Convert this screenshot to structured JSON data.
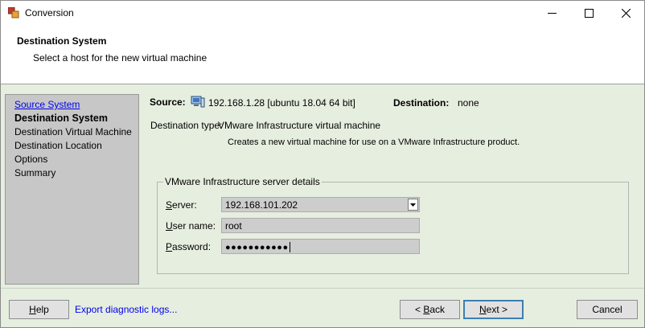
{
  "window": {
    "title": "Conversion",
    "icon": "vmware-converter-icon",
    "controls": [
      "minimize-icon",
      "maximize-icon",
      "close-icon"
    ]
  },
  "header": {
    "title": "Destination System",
    "subtitle": "Select a host for the new virtual machine"
  },
  "nav": {
    "items": [
      {
        "label": "Source System",
        "state": "link"
      },
      {
        "label": "Destination System",
        "state": "current"
      },
      {
        "label": "Destination Virtual Machine",
        "state": "normal"
      },
      {
        "label": "Destination Location",
        "state": "normal"
      },
      {
        "label": "Options",
        "state": "normal"
      },
      {
        "label": "Summary",
        "state": "normal"
      }
    ]
  },
  "content": {
    "source_label": "Source:",
    "source_icon": "computer-icon",
    "source_value": "192.168.1.28 [ubuntu 18.04 64 bit]",
    "destination_label": "Destination:",
    "destination_value": "none",
    "destination_type_label": "Destination type:",
    "destination_type_value": "VMware Infrastructure virtual machine",
    "destination_type_description": "Creates a new virtual machine for use on a VMware Infrastructure product."
  },
  "server_details": {
    "legend": "VMware Infrastructure server details",
    "server_label_prefix": "",
    "server_label_accel": "S",
    "server_label_rest": "erver:",
    "server_value": "192.168.101.202",
    "username_label_accel": "U",
    "username_label_rest": "ser name:",
    "username_value": "root",
    "password_label_accel": "P",
    "password_label_rest": "assword:",
    "password_value": "●●●●●●●●●●●"
  },
  "footer": {
    "help_accel": "H",
    "help_rest": "elp",
    "export_link": "Export diagnostic logs...",
    "back_prefix": "< ",
    "back_accel": "B",
    "back_rest": "ack",
    "next_accel": "N",
    "next_rest": "ext >",
    "cancel_label": "Cancel"
  },
  "colors": {
    "panel_bg": "#e6eedf",
    "nav_bg": "#c7c7c7",
    "link": "#0000ee",
    "focus_border": "#3c7fb1"
  }
}
